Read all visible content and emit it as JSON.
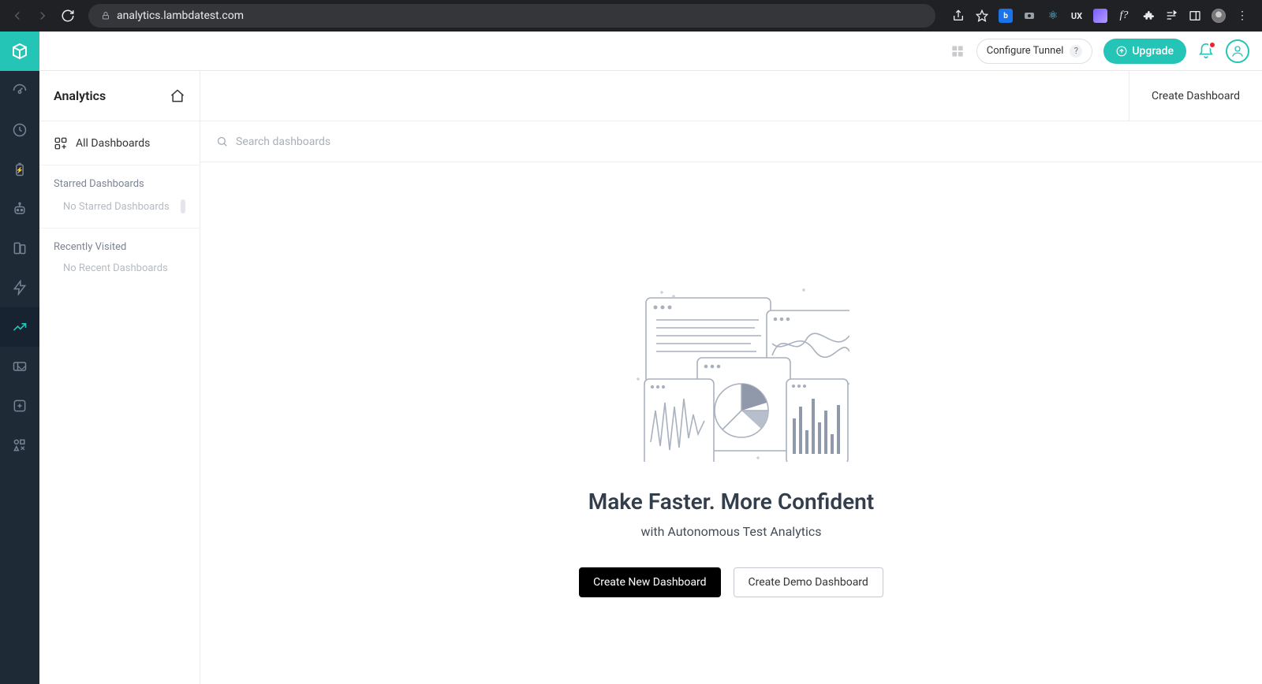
{
  "browser": {
    "url": "analytics.lambdatest.com"
  },
  "header": {
    "configure_tunnel": "Configure Tunnel",
    "upgrade": "Upgrade"
  },
  "sidebar": {
    "title": "Analytics",
    "all_dashboards": "All Dashboards",
    "starred_label": "Starred Dashboards",
    "starred_empty": "No Starred Dashboards",
    "recent_label": "Recently Visited",
    "recent_empty": "No Recent Dashboards"
  },
  "content": {
    "create_dashboard": "Create Dashboard",
    "search_placeholder": "Search dashboards",
    "empty_headline": "Make Faster. More Confident",
    "empty_sub": "with Autonomous Test Analytics",
    "create_new": "Create New Dashboard",
    "create_demo": "Create Demo Dashboard"
  }
}
